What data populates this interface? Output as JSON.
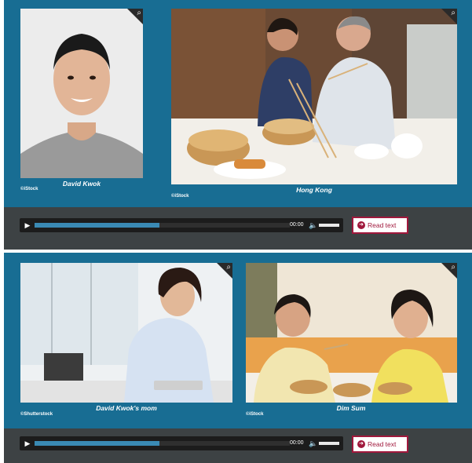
{
  "section1": {
    "photos": [
      {
        "caption": "David Kwok",
        "credit": "©iStock"
      },
      {
        "caption": "Hong Kong",
        "credit": "©iStock"
      }
    ],
    "audio": {
      "time": "00:00",
      "progress": 0.49
    },
    "read_text_label": "Read text"
  },
  "section2": {
    "photos": [
      {
        "caption": "David Kwok's mom",
        "credit": "©Shutterstock"
      },
      {
        "caption": "Dim Sum",
        "credit": "©iStock"
      }
    ],
    "audio": {
      "time": "00:00",
      "progress": 0.49
    },
    "read_text_label": "Read text"
  },
  "icons": {
    "zoom": "magnifier-icon",
    "play": "play-icon",
    "volume": "volume-icon",
    "read": "arrow-circle-icon"
  },
  "colors": {
    "panel": "#186d93",
    "bar": "#3d4244",
    "accent": "#a0183c",
    "progress": "#3a8ab4"
  }
}
